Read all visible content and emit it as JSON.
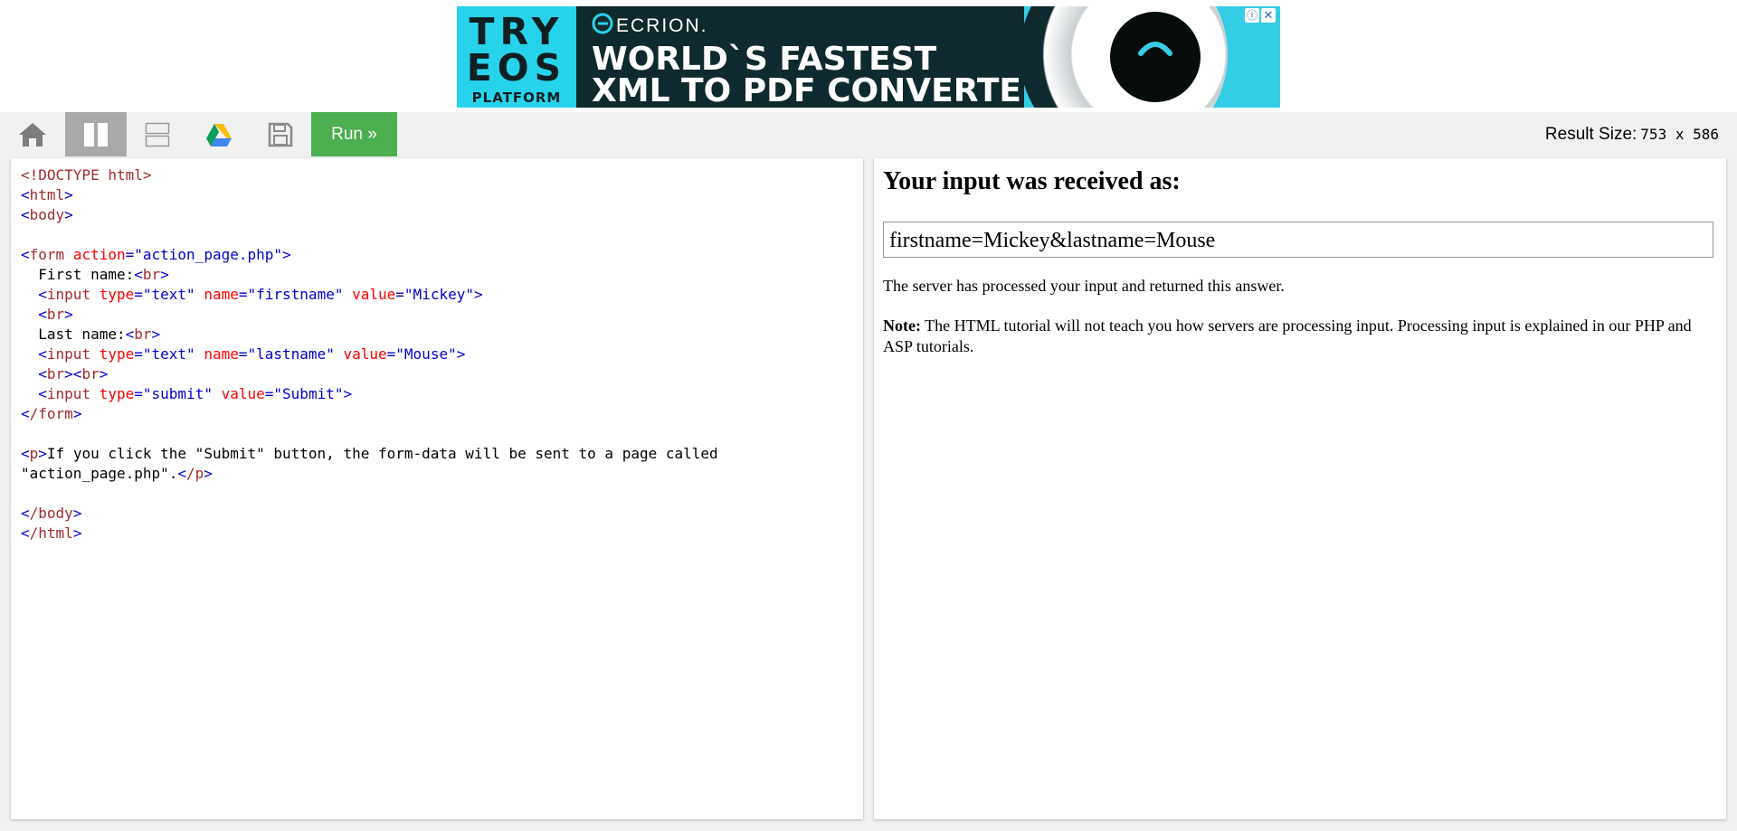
{
  "ad": {
    "left_line1": "TRY",
    "left_line2": "EOS",
    "left_line3": "PLATFORM",
    "brand": "ECRION.",
    "headline1": "WORLD`S FASTEST",
    "headline2": "XML TO PDF CONVERTER",
    "info_glyph": "ⓘ",
    "close_glyph": "✕",
    "colors": {
      "cyan": "#27d3ea",
      "dark": "#0f2a2e"
    }
  },
  "toolbar": {
    "home_icon": "home-icon",
    "columns_icon": "columns-layout-icon",
    "rows_icon": "rows-layout-icon",
    "drive_icon": "google-drive-icon",
    "save_icon": "save-icon",
    "run_label": "Run »",
    "size_label": "Result Size:",
    "size_value": "753 x 586",
    "colors": {
      "run": "#4caf50",
      "active": "#a9a9a9",
      "bar": "#f1f1f1"
    }
  },
  "code": {
    "doctype": "<!DOCTYPE html>",
    "l_html_open": "html",
    "l_body_open": "body",
    "form_tag": "form",
    "form_attr": "action",
    "form_val": "\"action_page.php\"",
    "first_label": "  First name:",
    "br": "br",
    "input": "input",
    "type_attr": "type",
    "name_attr": "name",
    "value_attr": "value",
    "val_text": "\"text\"",
    "val_firstname": "\"firstname\"",
    "val_mickey": "\"Mickey\"",
    "last_label": "  Last name:",
    "val_lastname": "\"lastname\"",
    "val_mouse": "\"Mouse\"",
    "val_submit": "\"submit\"",
    "val_submit2": "\"Submit\"",
    "form_close": "/form",
    "p_tag": "p",
    "p_text1": "If you click the \"Submit\" button, the form-data will be sent to a page called",
    "p_text2": "\"action_page.php\".",
    "p_close": "/p",
    "body_close": "/body",
    "html_close": "/html"
  },
  "result": {
    "heading": "Your input was received as:",
    "received": "firstname=Mickey&lastname=Mouse",
    "processed": "The server has processed your input and returned this answer.",
    "note_label": "Note:",
    "note_text": " The HTML tutorial will not teach you how servers are processing input. Processing input is explained in our PHP and ASP tutorials."
  }
}
